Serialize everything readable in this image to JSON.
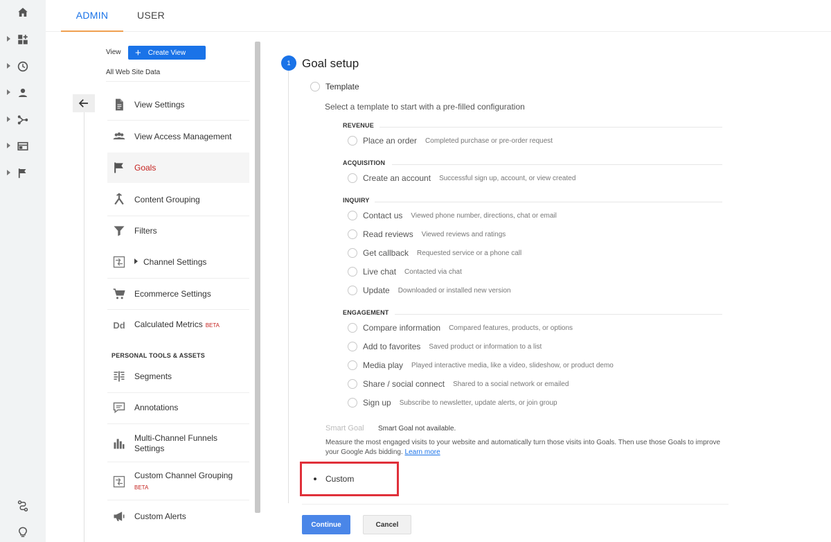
{
  "top_tabs": {
    "admin": "ADMIN",
    "user": "USER"
  },
  "rail": {
    "icons": [
      "home-icon",
      "dashboard-icon",
      "clock-icon",
      "person-icon",
      "acquisition-icon",
      "behavior-icon",
      "flag-icon",
      "attribution-icon",
      "lightbulb-icon"
    ]
  },
  "view": {
    "label": "View",
    "create_label": "Create View",
    "current": "All Web Site Data"
  },
  "menu": {
    "items": [
      {
        "label": "View Settings",
        "icon": "document-icon"
      },
      {
        "label": "View Access Management",
        "icon": "people-icon"
      },
      {
        "label": "Goals",
        "icon": "flag-icon"
      },
      {
        "label": "Content Grouping",
        "icon": "grouping-icon"
      },
      {
        "label": "Filters",
        "icon": "filter-icon"
      },
      {
        "label": "Channel Settings",
        "icon": "channel-icon"
      },
      {
        "label": "Ecommerce Settings",
        "icon": "cart-icon"
      },
      {
        "label": "Calculated Metrics",
        "icon": "dd-icon",
        "badge": "BETA"
      }
    ],
    "personal_heading": "PERSONAL TOOLS & ASSETS",
    "personal_items": [
      {
        "label": "Segments",
        "icon": "segments-icon"
      },
      {
        "label": "Annotations",
        "icon": "annotation-icon"
      },
      {
        "label_line1": "Multi-Channel Funnels",
        "label_line2": "Settings",
        "icon": "bar-chart-icon"
      },
      {
        "label": "Custom Channel Grouping",
        "icon": "channel-icon",
        "badge": "BETA"
      },
      {
        "label": "Custom Alerts",
        "icon": "megaphone-icon"
      }
    ],
    "icon_glyphs": {
      "dd": "Dd"
    }
  },
  "goal": {
    "step_number": "1",
    "title": "Goal setup",
    "template_label": "Template",
    "template_desc": "Select a template to start with a pre-filled configuration",
    "groups": [
      {
        "name": "REVENUE",
        "options": [
          {
            "label": "Place an order",
            "desc": "Completed purchase or pre-order request"
          }
        ]
      },
      {
        "name": "ACQUISITION",
        "options": [
          {
            "label": "Create an account",
            "desc": "Successful sign up, account, or view created"
          }
        ]
      },
      {
        "name": "INQUIRY",
        "options": [
          {
            "label": "Contact us",
            "desc": "Viewed phone number, directions, chat or email"
          },
          {
            "label": "Read reviews",
            "desc": "Viewed reviews and ratings"
          },
          {
            "label": "Get callback",
            "desc": "Requested service or a phone call"
          },
          {
            "label": "Live chat",
            "desc": "Contacted via chat"
          },
          {
            "label": "Update",
            "desc": "Downloaded or installed new version"
          }
        ]
      },
      {
        "name": "ENGAGEMENT",
        "options": [
          {
            "label": "Compare information",
            "desc": "Compared features, products, or options"
          },
          {
            "label": "Add to favorites",
            "desc": "Saved product or information to a list"
          },
          {
            "label": "Media play",
            "desc": "Played interactive media, like a video, slideshow, or product demo"
          },
          {
            "label": "Share / social connect",
            "desc": "Shared to a social network or emailed"
          },
          {
            "label": "Sign up",
            "desc": "Subscribe to newsletter, update alerts, or join group"
          }
        ]
      }
    ],
    "smart_goal_label": "Smart Goal",
    "smart_goal_na": "Smart Goal not available.",
    "smart_goal_desc": "Measure the most engaged visits to your website and automatically turn those visits into Goals. Then use those Goals to improve your Google Ads bidding.",
    "learn_more": "Learn more",
    "custom_label": "Custom",
    "custom_selected": true
  },
  "buttons": {
    "continue": "Continue",
    "cancel": "Cancel"
  },
  "colors": {
    "accent": "#1a73e8",
    "active_red": "#c5221f",
    "highlight_box": "#e0303a"
  }
}
